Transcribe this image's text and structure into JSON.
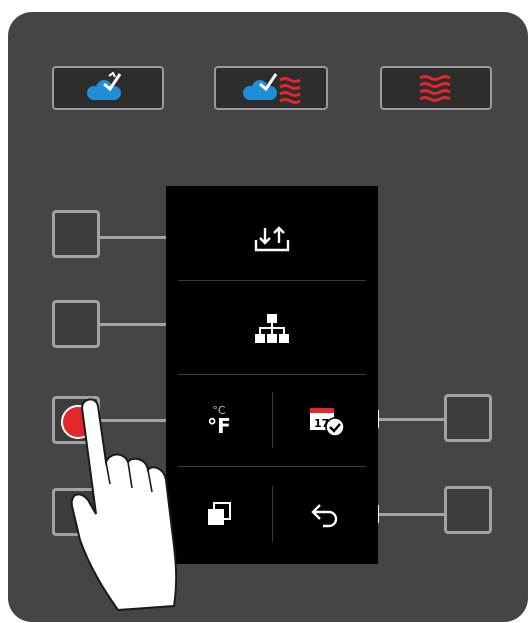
{
  "top_buttons": [
    {
      "icon": "steam-icon",
      "color": "#1e8fd6"
    },
    {
      "icon": "combi-steam-hotair-icon",
      "color": "#1e8fd6",
      "accent": "#e2262b"
    },
    {
      "icon": "hot-air-icon",
      "color": "#e2262b"
    }
  ],
  "screen": {
    "rows": [
      {
        "icon": "import-export-icon"
      },
      {
        "icon": "hierarchy-icon"
      },
      {
        "left_icon": "temperature-unit-icon",
        "units": {
          "small": "°C",
          "big": "°F"
        },
        "right_icon": "calendar-check-icon",
        "calendar_day": "17"
      },
      {
        "left_icon": "copy-icon",
        "right_icon": "back-icon"
      }
    ]
  },
  "colors": {
    "panel": "#454545",
    "accent_red": "#e2262b",
    "accent_blue": "#1e8fd6",
    "frame": "#a3a3a3"
  },
  "active_button": "left-button-3"
}
